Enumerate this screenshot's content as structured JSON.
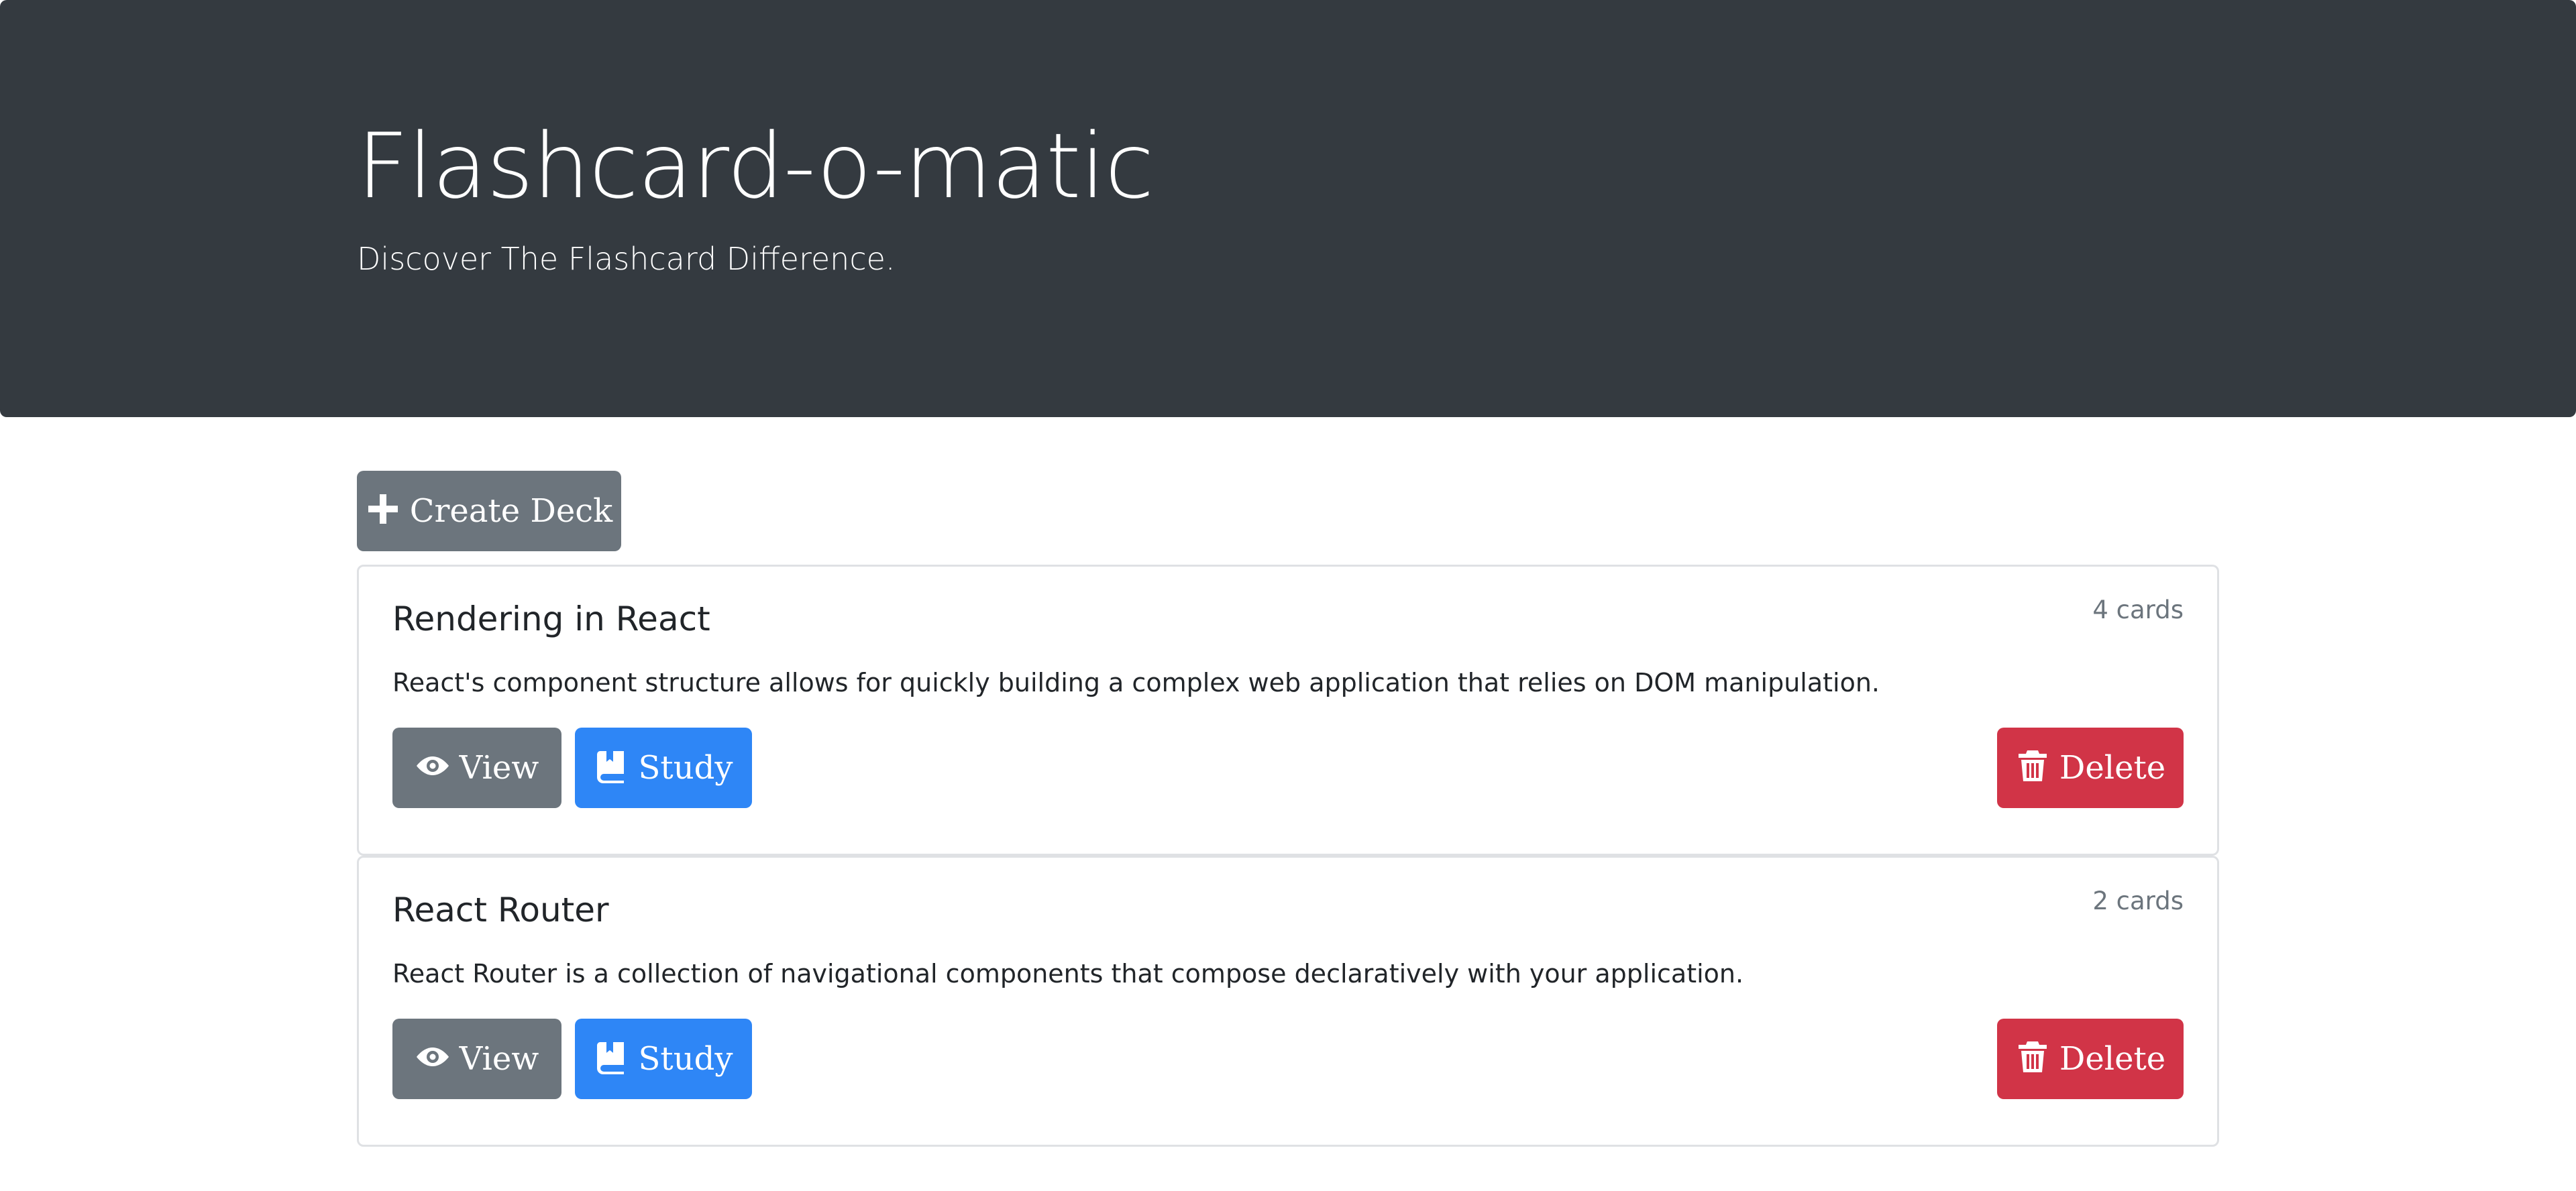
{
  "header": {
    "title": "Flashcard-o-matic",
    "subtitle": "Discover The Flashcard Difference."
  },
  "toolbar": {
    "create_label": "Create Deck"
  },
  "decks": [
    {
      "name": "Rendering in React",
      "count": "4 cards",
      "description": "React's component structure allows for quickly building a complex web application that relies on DOM manipulation.",
      "view_label": "View",
      "study_label": "Study",
      "delete_label": "Delete"
    },
    {
      "name": "React Router",
      "count": "2 cards",
      "description": "React Router is a collection of navigational components that compose declaratively with your application.",
      "view_label": "View",
      "study_label": "Study",
      "delete_label": "Delete"
    }
  ],
  "icons": {
    "create": "plus-icon",
    "view": "eye-icon",
    "study": "book-icon",
    "delete": "trash-icon"
  },
  "colors": {
    "header_bg": "#343a40",
    "secondary": "#6c757d",
    "primary": "#2e86f6",
    "danger": "#d13447"
  }
}
